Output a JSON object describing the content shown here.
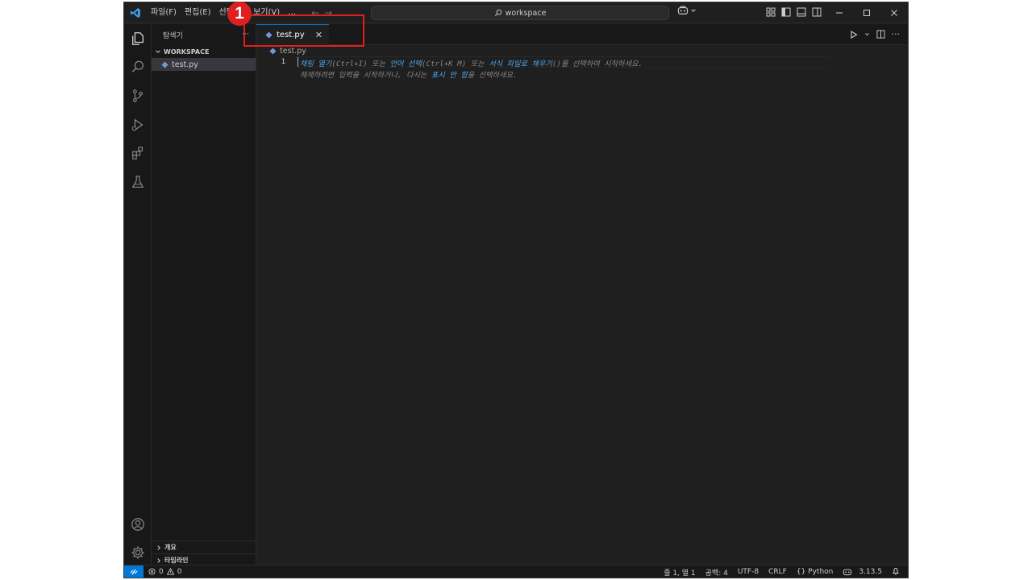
{
  "titlebar": {
    "menu": [
      "파일(F)",
      "편집(E)",
      "선택(S)",
      "보기(V)",
      "…"
    ],
    "nav_back": "←",
    "nav_forward": "→",
    "search_placeholder": "workspace"
  },
  "sidebar": {
    "title": "탐색기",
    "more": "···",
    "folder": "WORKSPACE",
    "file": "test.py",
    "sections": [
      "개요",
      "타임라인"
    ]
  },
  "editor": {
    "tab_label": "test.py",
    "tab_close": "✕",
    "more": "···",
    "breadcrumb_file": "test.py",
    "line_number": "1",
    "hint_line1": {
      "p1": "채팅 열기",
      "p2": "(Ctrl+I) 또는 ",
      "p3": "언어 선택",
      "p4": "(Ctrl+K M) 또는 ",
      "p5": "서식 파일로 채우기",
      "p6": "()를 선택하여 시작하세요."
    },
    "hint_line2": {
      "p1": "해제하려면 입력을 시작하거나, 다시는 ",
      "p2": "표시 안 함",
      "p3": "을 선택하세요."
    }
  },
  "statusbar": {
    "remote": "⚡",
    "errors": "0",
    "warnings": "0",
    "position": "줄 1, 열 1",
    "spaces": "공백: 4",
    "encoding": "UTF-8",
    "eol": "CRLF",
    "language_braces": "{}",
    "language": "Python",
    "python_version": "3.13.5",
    "bell": "🔔"
  },
  "annotation": {
    "badge": "1"
  },
  "colors": {
    "accent": "#0078d4",
    "annotation": "#e02020",
    "hint_link": "#4fa7e8"
  }
}
